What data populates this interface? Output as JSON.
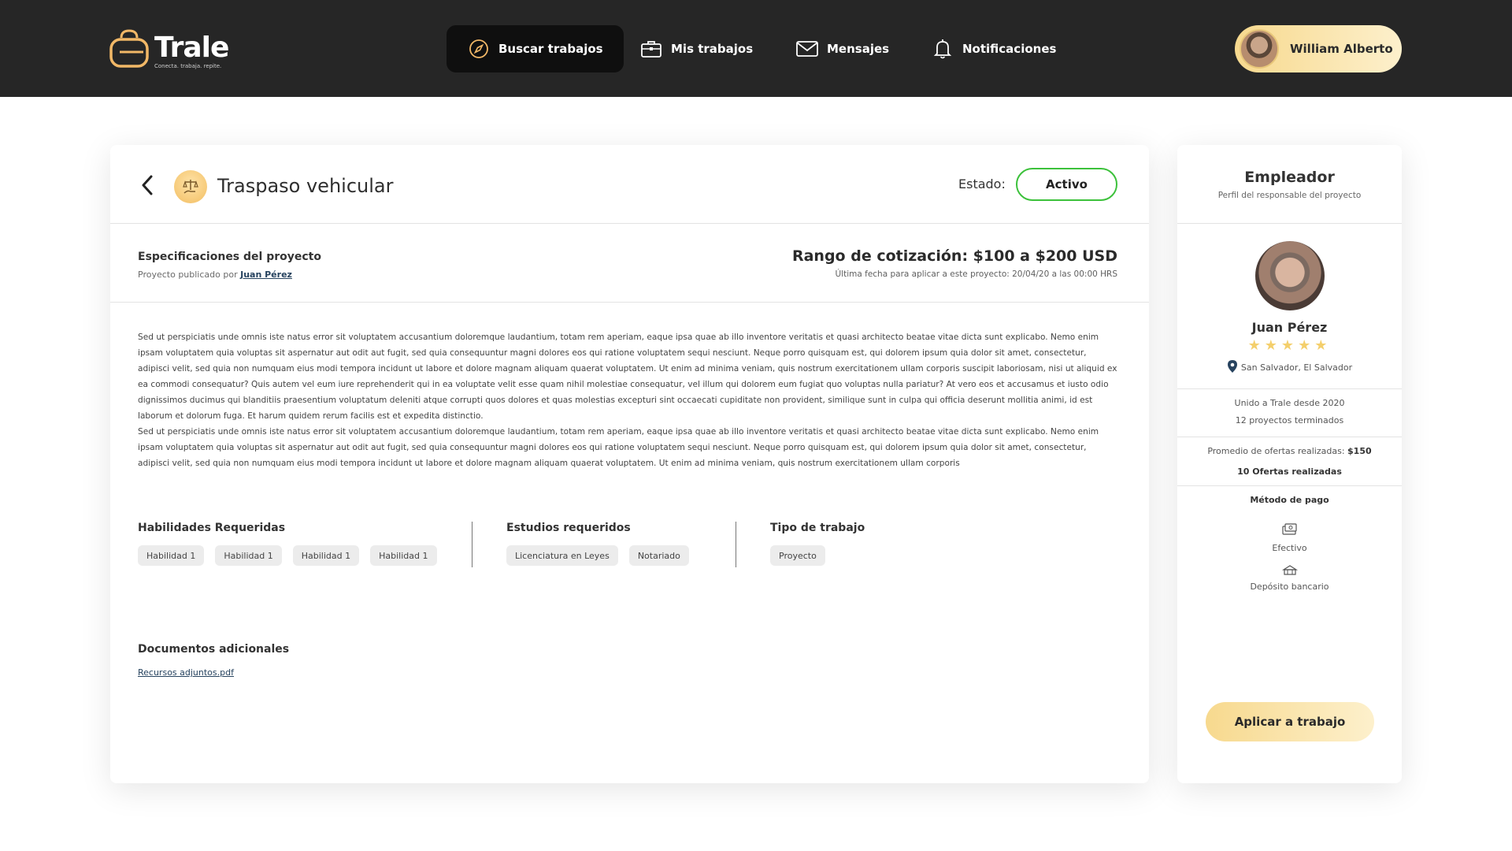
{
  "brand": {
    "name": "Trale",
    "tagline": "Conecta. trabaja. repite."
  },
  "nav": {
    "items": [
      {
        "label": "Buscar trabajos",
        "icon": "compass-icon",
        "active": true
      },
      {
        "label": "Mis trabajos",
        "icon": "briefcase-icon",
        "active": false
      },
      {
        "label": "Mensajes",
        "icon": "mail-icon",
        "active": false
      },
      {
        "label": "Notificaciones",
        "icon": "bell-icon",
        "active": false
      }
    ]
  },
  "user": {
    "name": "William Alberto"
  },
  "project": {
    "title": "Traspaso vehicular",
    "status_label": "Estado:",
    "status": "Activo",
    "spec_title": "Especificaciones del proyecto",
    "published_by_prefix": "Proyecto publicado por",
    "published_by": "Juan Pérez",
    "quote_range": "Rango de cotización: $100 a $200 USD",
    "deadline": "Última fecha para aplicar a este proyecto: 20/04/20 a las 00:00 HRS",
    "description": [
      "Sed ut perspiciatis unde omnis iste natus error sit voluptatem accusantium doloremque laudantium, totam rem aperiam, eaque ipsa quae ab illo inventore veritatis et quasi architecto beatae vitae dicta sunt explicabo. Nemo enim ipsam voluptatem quia voluptas sit aspernatur aut odit aut fugit, sed quia consequuntur magni dolores eos qui ratione voluptatem sequi nesciunt. Neque porro quisquam est, qui dolorem ipsum quia dolor sit amet, consectetur, adipisci velit, sed quia non numquam eius modi tempora incidunt ut labore et dolore magnam aliquam quaerat voluptatem. Ut enim ad minima veniam, quis nostrum exercitationem ullam corporis suscipit laboriosam, nisi ut aliquid ex ea commodi consequatur? Quis autem vel eum iure reprehenderit qui in ea voluptate velit esse quam nihil molestiae consequatur, vel illum qui dolorem eum fugiat quo voluptas nulla pariatur? At vero eos et accusamus et iusto odio dignissimos ducimus qui blanditiis praesentium voluptatum deleniti atque corrupti quos dolores et quas molestias excepturi sint occaecati cupiditate non provident, similique sunt in culpa qui officia deserunt mollitia animi, id est laborum et dolorum fuga. Et harum quidem rerum facilis est et expedita distinctio.",
      "Sed ut perspiciatis unde omnis iste natus error sit voluptatem accusantium doloremque laudantium, totam rem aperiam, eaque ipsa quae ab illo inventore veritatis et quasi architecto beatae vitae dicta sunt explicabo. Nemo enim ipsam voluptatem quia voluptas sit aspernatur aut odit aut fugit, sed quia consequuntur magni dolores eos qui ratione voluptatem sequi nesciunt. Neque porro quisquam est, qui dolorem ipsum quia dolor sit amet, consectetur, adipisci velit, sed quia non numquam eius modi tempora incidunt ut labore et dolore magnam aliquam quaerat voluptatem. Ut enim ad minima veniam, quis nostrum exercitationem ullam corporis"
    ],
    "skills_title": "Habilidades Requeridas",
    "skills": [
      "Habilidad 1",
      "Habilidad 1",
      "Habilidad 1",
      "Habilidad 1"
    ],
    "studies_title": "Estudios requeridos",
    "studies": [
      "Licenciatura en Leyes",
      "Notariado"
    ],
    "work_type_title": "Tipo de trabajo",
    "work_type": [
      "Proyecto"
    ],
    "docs_title": "Documentos adicionales",
    "docs_link": "Recursos adjuntos.pdf"
  },
  "employer": {
    "title": "Empleador",
    "subtitle": "Perfil del responsable del proyecto",
    "name": "Juan Pérez",
    "rating": 5,
    "stars": "★★★★★",
    "location": "San Salvador, El Salvador",
    "joined": "Unido a Trale desde 2020",
    "completed": "12 proyectos terminados",
    "avg_offer_label": "Promedio de ofertas realizadas:",
    "avg_offer_value": "$150",
    "offers_count": "10 Ofertas realizadas",
    "payment_title": "Método de pago",
    "payment_methods": [
      "Efectivo",
      "Depósito bancario"
    ],
    "apply_label": "Aplicar a trabajo"
  },
  "colors": {
    "topbar": "#262626",
    "accent": "#f7d98e",
    "active_status": "#3cc13b",
    "link": "#27435f"
  }
}
